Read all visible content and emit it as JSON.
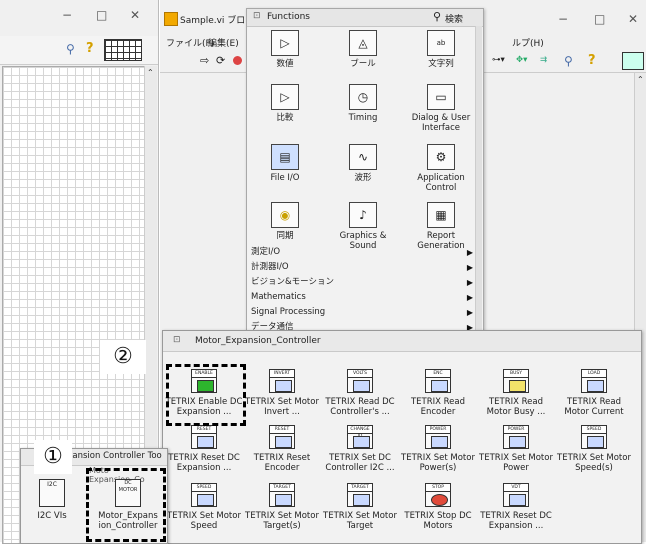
{
  "left_window": {
    "controls": [
      "−",
      "□",
      "✕"
    ]
  },
  "main_window": {
    "title": "Sample.vi ブロック",
    "menus": [
      "ファイル(F)",
      "編集(E)",
      "ルプ(H)"
    ],
    "controls": [
      "−",
      "□",
      "✕"
    ]
  },
  "functions_palette": {
    "title": "Functions",
    "search_label": "検索",
    "items": [
      {
        "label": "数値",
        "icon": "numeric-icon"
      },
      {
        "label": "ブール",
        "icon": "boolean-icon"
      },
      {
        "label": "文字列",
        "icon": "string-icon"
      },
      {
        "label": "比較",
        "icon": "comparison-icon"
      },
      {
        "label": "Timing",
        "icon": "timing-icon"
      },
      {
        "label": "Dialog & User Interface",
        "icon": "dialog-icon"
      },
      {
        "label": "File I/O",
        "icon": "file-io-icon"
      },
      {
        "label": "波形",
        "icon": "waveform-icon"
      },
      {
        "label": "Application Control",
        "icon": "app-control-icon"
      },
      {
        "label": "同期",
        "icon": "sync-icon"
      },
      {
        "label": "Graphics & Sound",
        "icon": "graphics-sound-icon"
      },
      {
        "label": "Report Generation",
        "icon": "report-icon"
      }
    ],
    "categories": [
      "測定I/O",
      "計測器I/O",
      "ビジョン&モーション",
      "Mathematics",
      "Signal Processing",
      "データ通信"
    ]
  },
  "motor_palette": {
    "title": "Motor_Expansion_Controller",
    "items": [
      {
        "label": "TETRIX Enable DC Expansion ...",
        "tag": "ENABLE"
      },
      {
        "label": "TETRIX Set Motor Invert ...",
        "tag": "INVERT"
      },
      {
        "label": "TETRIX Read DC Controller's ...",
        "tag": "VOLTS"
      },
      {
        "label": "TETRIX Read Encoder",
        "tag": "ENC"
      },
      {
        "label": "TETRIX Read Motor Busy ...",
        "tag": "BUSY"
      },
      {
        "label": "TETRIX Read Motor Current",
        "tag": "LOAD"
      },
      {
        "label": "TETRIX Reset DC Expansion ...",
        "tag": "RESET"
      },
      {
        "label": "TETRIX Reset Encoder",
        "tag": "RESET"
      },
      {
        "label": "TETRIX Set DC Controller I2C ...",
        "tag": "CHANGE ID"
      },
      {
        "label": "TETRIX Set Motor Power(s)",
        "tag": "POWER"
      },
      {
        "label": "TETRIX Set Motor Power",
        "tag": "POWER"
      },
      {
        "label": "TETRIX Set Motor Speed(s)",
        "tag": "SPEED"
      },
      {
        "label": "TETRIX Set Motor Speed",
        "tag": "SPEED"
      },
      {
        "label": "TETRIX Set Motor Target(s)",
        "tag": "TARGET"
      },
      {
        "label": "TETRIX Set Motor Target",
        "tag": "TARGET"
      },
      {
        "label": "TETRIX Stop DC Motors",
        "tag": "STOP"
      },
      {
        "label": "TETRIX Reset DC Expansion ...",
        "tag": "VDT"
      }
    ]
  },
  "toolkit_palette": {
    "title_fragment": "pansion Controller Too",
    "subtitle_fragment": "Moto  Expansion_Co",
    "items": [
      {
        "label": "I2C VIs",
        "tag": "I2C"
      },
      {
        "label": "Motor_Expansion_Controller",
        "tag": "DC MOTOR"
      }
    ]
  },
  "annotations": {
    "step1": "①",
    "step2": "②"
  }
}
